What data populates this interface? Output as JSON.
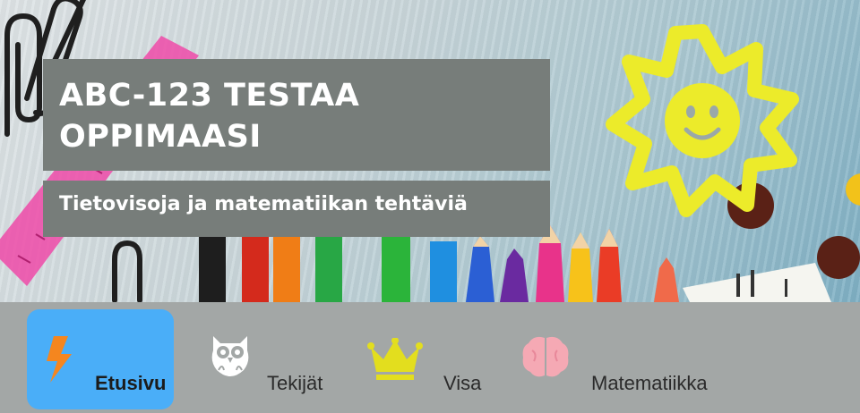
{
  "header": {
    "title": "ABC-123 TESTAA OPPIMAASI",
    "subtitle": "Tietovisoja ja matematiikan tehtäviä"
  },
  "nav": {
    "items": [
      {
        "label": "Etusivu",
        "icon": "lightning-icon",
        "active": true
      },
      {
        "label": "Tekijät",
        "icon": "owl-icon",
        "active": false
      },
      {
        "label": "Visa",
        "icon": "crown-icon",
        "active": false
      },
      {
        "label": "Matematiikka",
        "icon": "brain-icon",
        "active": false
      }
    ]
  },
  "colors": {
    "title_box": "#777d7a",
    "nav_background": "#a3a7a6",
    "nav_active": "#4aaef8",
    "sun": "#eceb2a",
    "lightning": "#f5861f",
    "crown": "#e3de1e",
    "brain": "#f5a9b4"
  }
}
